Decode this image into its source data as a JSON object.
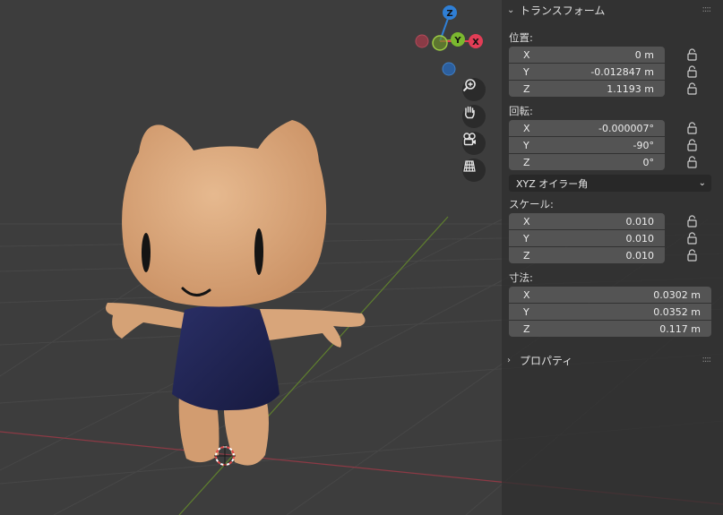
{
  "gizmo": {
    "z_label": "Z",
    "y_label": "Y",
    "x_label": "X"
  },
  "nav_buttons": [
    {
      "name": "zoom-icon"
    },
    {
      "name": "hand-pan-icon"
    },
    {
      "name": "camera-view-icon"
    },
    {
      "name": "grid-ortho-icon"
    }
  ],
  "panel": {
    "transform_title": "トランスフォーム",
    "location": {
      "label": "位置:",
      "x": "0 m",
      "y": "-0.012847 m",
      "z": "1.1193 m"
    },
    "rotation": {
      "label": "回転:",
      "x": "-0.000007°",
      "y": "-90°",
      "z": "0°"
    },
    "rotation_mode": "XYZ オイラー角",
    "scale": {
      "label": "スケール:",
      "x": "0.010",
      "y": "0.010",
      "z": "0.010"
    },
    "dimensions": {
      "label": "寸法:",
      "x": "0.0302 m",
      "y": "0.0352 m",
      "z": "0.117 m"
    },
    "properties_title": "プロパティ",
    "axis": {
      "x": "X",
      "y": "Y",
      "z": "Z"
    }
  },
  "colors": {
    "background": "#3d3d3d",
    "x_axis": "#e23d56",
    "y_axis": "#7bb82f",
    "z_axis": "#2f7fd6",
    "skin": "#d9a47a",
    "dress": "#1f2350"
  }
}
